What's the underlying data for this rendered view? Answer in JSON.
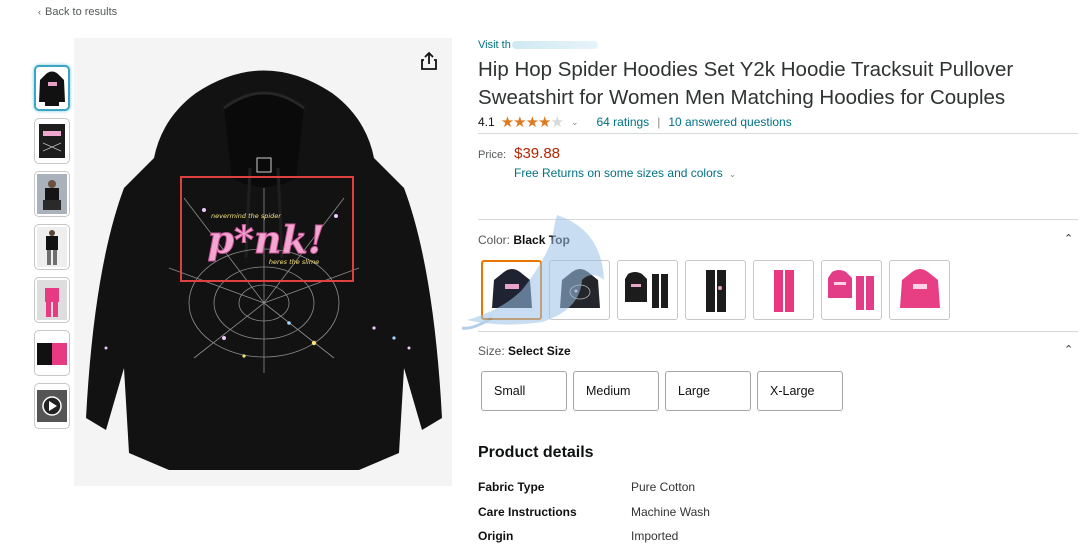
{
  "nav": {
    "back_label": "Back to results"
  },
  "product": {
    "store_link_prefix": "Visit th",
    "title": "Hip Hop Spider Hoodies Set Y2k Hoodie Tracksuit Pullover Sweatshirt for Women Men Matching Hoodies for Couples",
    "rating_value": "4.1",
    "rating_stars": 4.1,
    "ratings_count_label": "64 ratings",
    "questions_label": "10 answered questions",
    "price_label": "Price:",
    "price": "$39.88",
    "returns_label": "Free Returns on some sizes and colors",
    "image_print_text": "p*nk!",
    "image_print_small_top": "nevermind the spider",
    "image_print_small_bottom": "heres the slime"
  },
  "thumbnails": [
    {
      "name": "hoodie-front",
      "selected": true
    },
    {
      "name": "hoodie-detail",
      "selected": false
    },
    {
      "name": "model-sitting",
      "selected": false
    },
    {
      "name": "model-standing",
      "selected": false
    },
    {
      "name": "pink-set",
      "selected": false
    },
    {
      "name": "hoodie-pink-black",
      "selected": false
    },
    {
      "name": "video",
      "selected": false
    }
  ],
  "color": {
    "label": "Color:",
    "selected": "Black Top",
    "swatches": [
      {
        "name": "black-hoodie-front",
        "colour": "#1f2230",
        "selected": true
      },
      {
        "name": "black-hoodie-back",
        "colour": "#25262c",
        "selected": false
      },
      {
        "name": "black-tracksuit-set",
        "colour": "#1c1c1c",
        "selected": false
      },
      {
        "name": "black-pants",
        "colour": "#1c1c1c",
        "selected": false
      },
      {
        "name": "pink-pants",
        "colour": "#e8397e",
        "selected": false
      },
      {
        "name": "pink-tracksuit-set",
        "colour": "#e23d86",
        "selected": false
      },
      {
        "name": "pink-hoodie",
        "colour": "#e83f84",
        "selected": false
      }
    ]
  },
  "size": {
    "label": "Size:",
    "selected": "Select Size",
    "options": [
      "Small",
      "Medium",
      "Large",
      "X-Large"
    ]
  },
  "details": {
    "heading": "Product details",
    "rows": [
      {
        "key": "Fabric Type",
        "value": "Pure Cotton"
      },
      {
        "key": "Care Instructions",
        "value": "Machine Wash"
      },
      {
        "key": "Origin",
        "value": "Imported"
      }
    ]
  },
  "colors": {
    "link": "#007185",
    "price": "#b12704",
    "star": "#de7921",
    "selected_swatch_border": "#e77600",
    "annotation_box": "#e04040"
  }
}
